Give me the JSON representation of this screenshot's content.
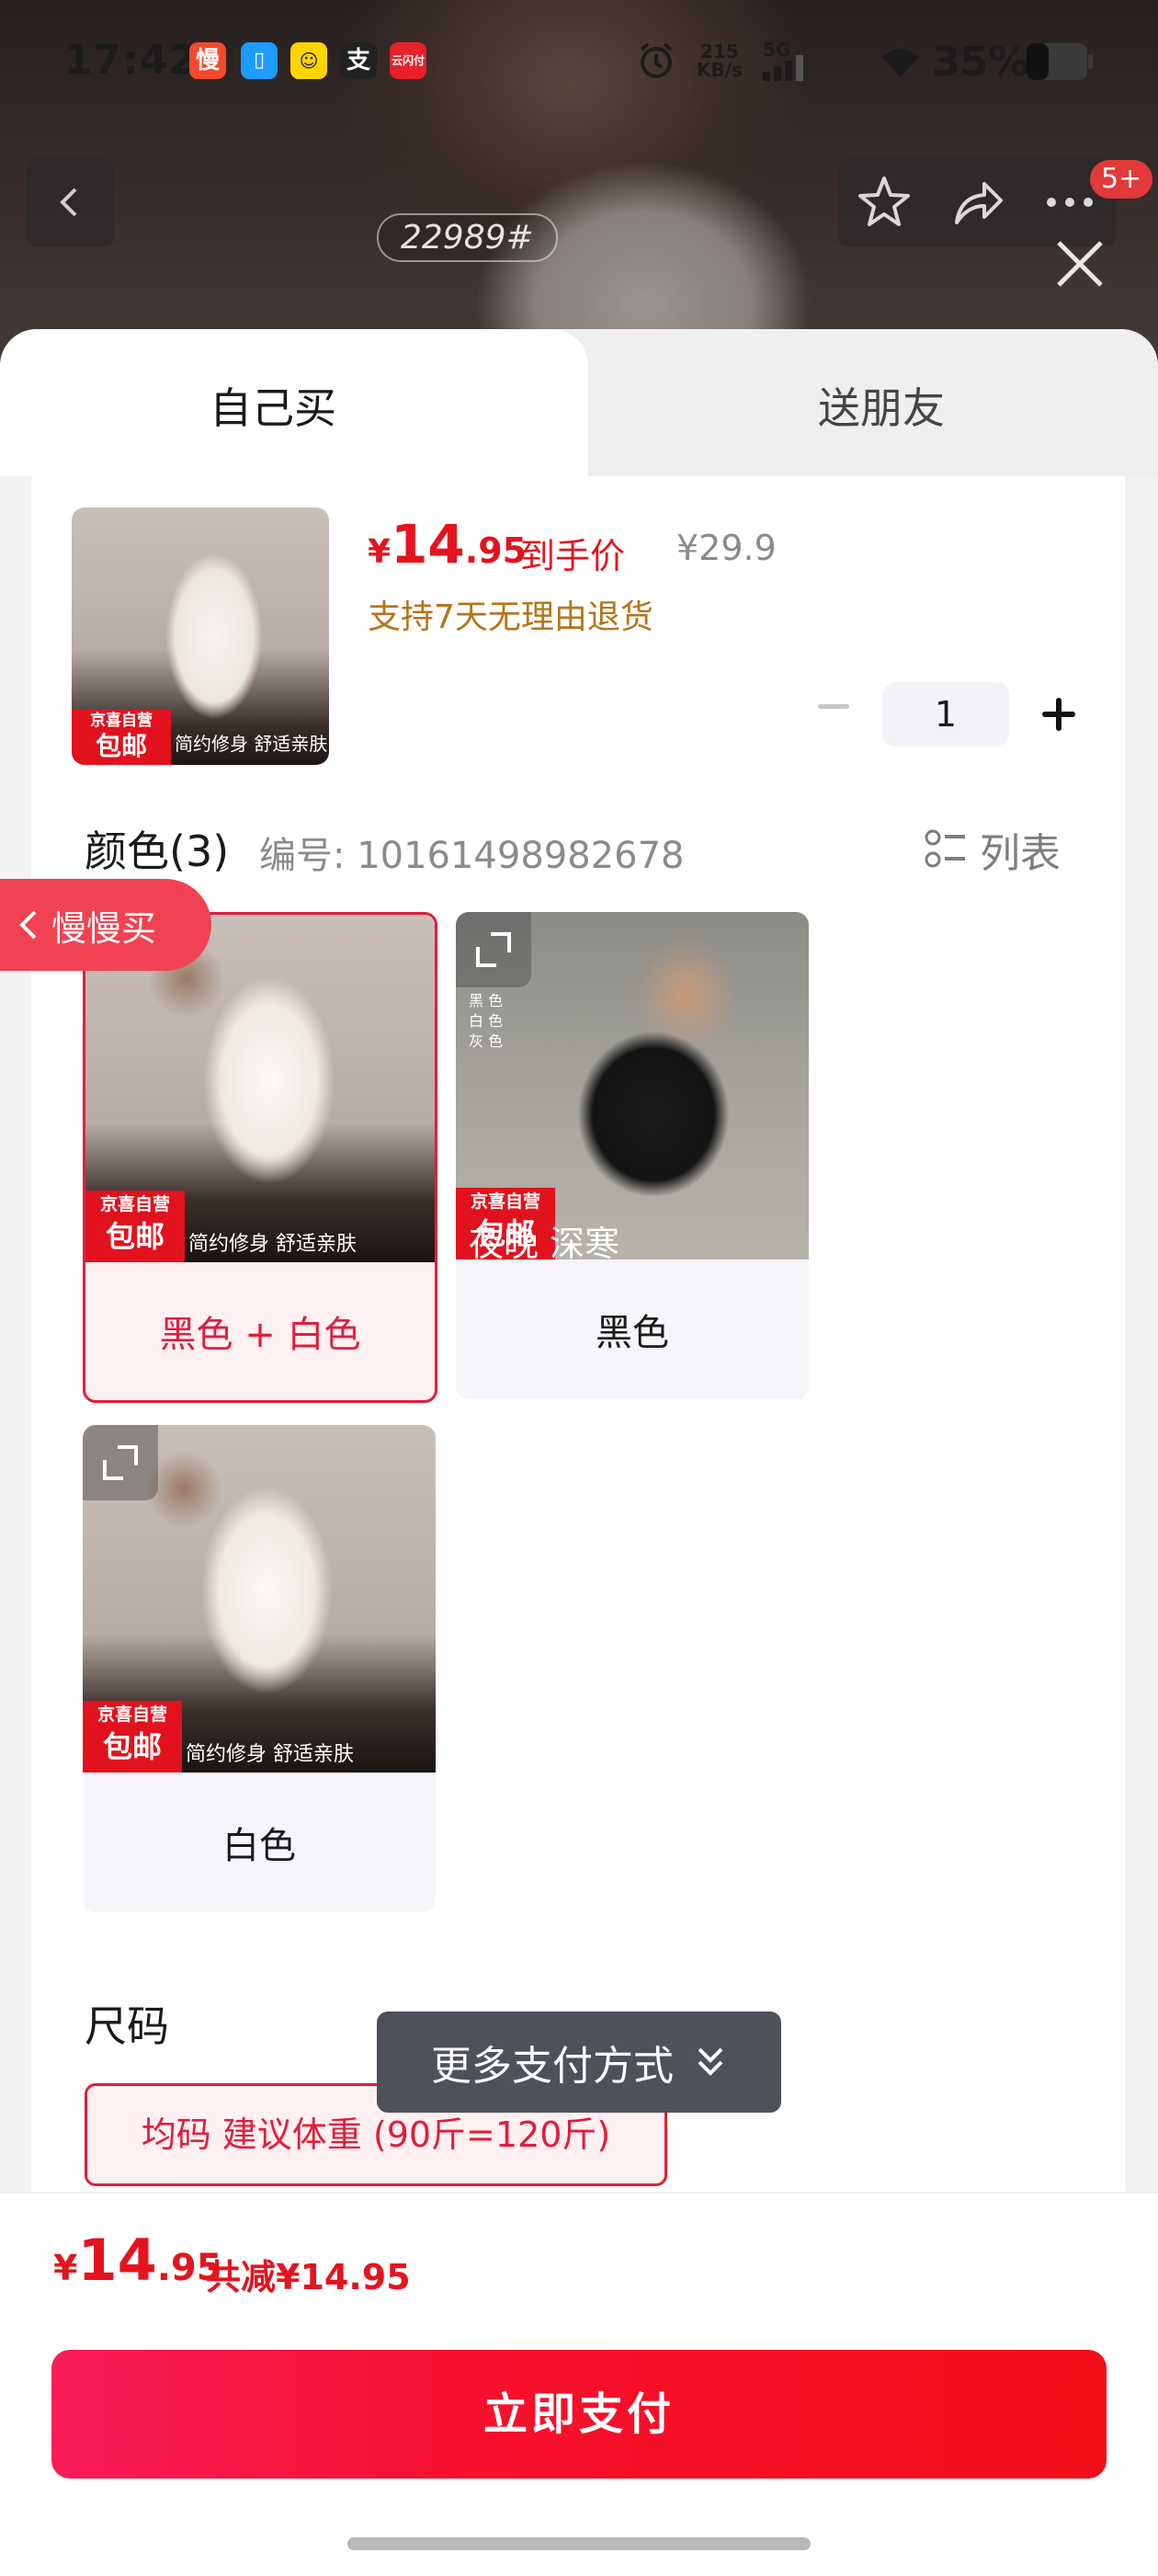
{
  "status_bar": {
    "time": "17:42",
    "app_icons": [
      "慢",
      "📱",
      "😀",
      "支",
      "云闪付"
    ],
    "net_speed_value": "215",
    "net_speed_unit": "KB/s",
    "signal": "5G",
    "battery": "35%"
  },
  "header": {
    "product_tag": "22989#",
    "badge": "5+"
  },
  "tabs": {
    "self_buy": "自己买",
    "gift_friend": "送朋友"
  },
  "product": {
    "thumb_badge_top": "京喜自营",
    "thumb_badge_bottom": "包邮",
    "thumb_caption": "简约修身 舒适亲肤",
    "price_yen": "¥",
    "price_int": "14",
    "price_dec": ".95",
    "price_label": "到手价",
    "original_price": "¥29.9",
    "return_policy": "支持7天无理由退货",
    "quantity": "1"
  },
  "color_section": {
    "title": "颜色(3)",
    "code": "编号: 10161498982678",
    "list_label": "列表",
    "options": [
      {
        "label": "黑色 + 白色",
        "badge_top": "京喜自营",
        "badge_bottom": "包邮",
        "caption": "简约修身 舒适亲肤",
        "selected": true
      },
      {
        "label": "黑色",
        "badge_top": "京喜自营",
        "badge_bottom": "包邮",
        "caption": "夜晚 深寒",
        "legend": "黑 色\n白 色\n灰 色",
        "selected": false
      },
      {
        "label": "白色",
        "badge_top": "京喜自营",
        "badge_bottom": "包邮",
        "caption": "简约修身 舒适亲肤",
        "selected": false
      }
    ]
  },
  "size_section": {
    "title": "尺码",
    "option": "均码 建议体重 (90斤=120斤)"
  },
  "floating": {
    "slow_buy": "慢慢买",
    "more_payment": "更多支付方式"
  },
  "bottom_bar": {
    "total_yen": "¥",
    "total_int": "14",
    "total_dec": ".95",
    "discount": "共减¥14.95",
    "pay_button": "立即支付"
  },
  "colors": {
    "accent_red": "#e4141e",
    "selected_border": "#e01e3c",
    "refund_text": "#b7741a"
  }
}
